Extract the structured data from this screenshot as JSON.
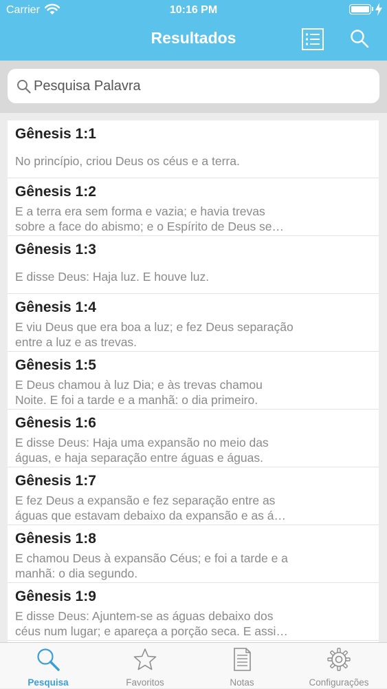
{
  "status_bar": {
    "carrier": "Carrier",
    "time": "10:16 PM"
  },
  "nav": {
    "title": "Resultados",
    "list_icon": "list-icon",
    "search_icon": "search-icon"
  },
  "search": {
    "placeholder": "Pesquisa Palavra",
    "value": ""
  },
  "results": [
    {
      "ref": "Gênesis 1:1",
      "lines": [
        "No princípio, criou Deus os céus e a terra."
      ]
    },
    {
      "ref": "Gênesis 1:2",
      "lines": [
        "E a terra era sem forma e vazia; e havia trevas",
        "sobre a face do abismo; e o Espírito de Deus se…"
      ]
    },
    {
      "ref": "Gênesis 1:3",
      "lines": [
        "E disse Deus: Haja luz. E houve luz."
      ]
    },
    {
      "ref": "Gênesis 1:4",
      "lines": [
        "E viu Deus que era boa a luz; e fez Deus separação",
        "entre a luz e as trevas."
      ]
    },
    {
      "ref": "Gênesis 1:5",
      "lines": [
        "E Deus chamou à luz Dia; e às trevas chamou",
        "Noite. E foi a tarde e a manhã: o dia primeiro."
      ]
    },
    {
      "ref": "Gênesis 1:6",
      "lines": [
        "E disse Deus: Haja uma expansão no meio das",
        "águas, e haja separação entre águas e águas."
      ]
    },
    {
      "ref": "Gênesis 1:7",
      "lines": [
        "E fez Deus a expansão e fez separação entre as",
        "águas que estavam debaixo da expansão e as á…"
      ]
    },
    {
      "ref": "Gênesis 1:8",
      "lines": [
        "E chamou Deus à expansão Céus; e foi a tarde e a",
        "manhã: o dia segundo."
      ]
    },
    {
      "ref": "Gênesis 1:9",
      "lines": [
        "E disse Deus: Ajuntem-se as águas debaixo dos",
        "céus num lugar; e apareça a porção seca. E assi…"
      ]
    }
  ],
  "tabs": [
    {
      "label": "Pesquisa",
      "icon": "magnifier-icon",
      "active": true
    },
    {
      "label": "Favoritos",
      "icon": "star-icon",
      "active": false
    },
    {
      "label": "Notas",
      "icon": "notes-icon",
      "active": false
    },
    {
      "label": "Configurações",
      "icon": "gear-icon",
      "active": false
    }
  ],
  "colors": {
    "header": "#5bc2ec",
    "active_tab": "#3a9fd6",
    "inactive_tab": "#8e8e8e"
  }
}
